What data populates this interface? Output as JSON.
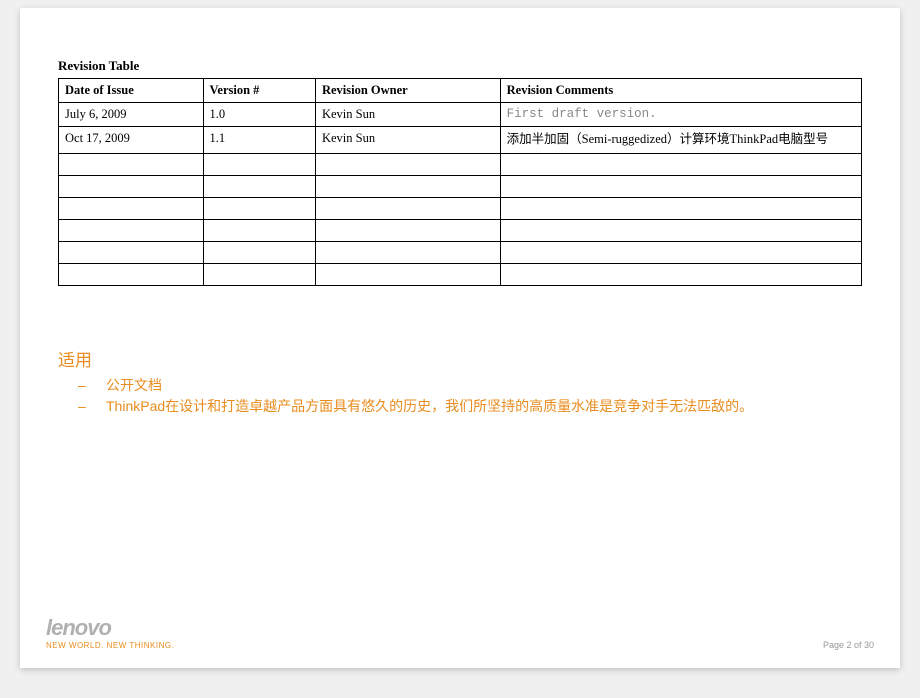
{
  "revision": {
    "title": "Revision Table",
    "headers": {
      "date": "Date of Issue",
      "version": "Version #",
      "owner": "Revision Owner",
      "comments": "Revision Comments"
    },
    "rows": [
      {
        "date": "July 6, 2009",
        "version": "1.0",
        "owner": "Kevin Sun",
        "comments": "First draft version.",
        "gray": true
      },
      {
        "date": "Oct 17, 2009",
        "version": "1.1",
        "owner": "Kevin Sun",
        "comments": "添加半加固（Semi-ruggedized）计算环境ThinkPad电脑型号",
        "gray": false
      }
    ]
  },
  "section": {
    "heading": "适用",
    "bullets": [
      "公开文档",
      "ThinkPad在设计和打造卓越产品方面具有悠久的历史，我们所坚持的高质量水准是竞争对手无法匹敌的。"
    ]
  },
  "footer": {
    "logo": "lenovo",
    "tagline": "NEW WORLD. NEW THINKING.",
    "page": "Page 2 of 30"
  }
}
